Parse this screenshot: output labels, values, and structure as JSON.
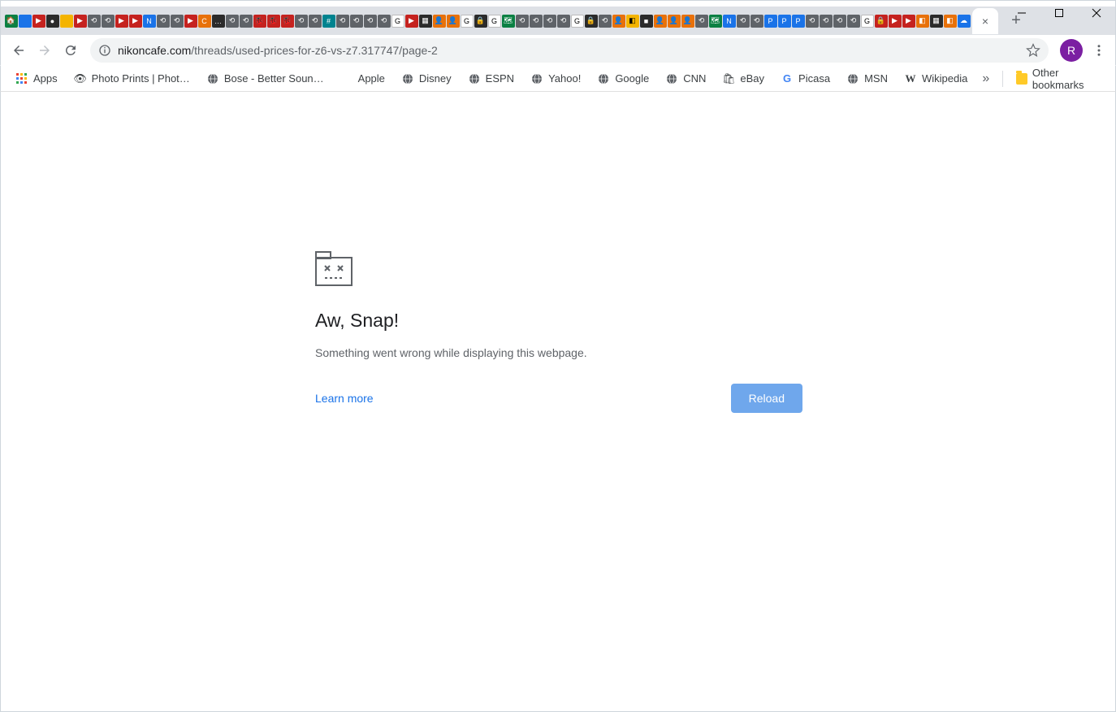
{
  "window": {
    "minimize": "–",
    "maximize": "❐",
    "close": "✕"
  },
  "toolbar": {
    "url_host": "nikoncafe.com",
    "url_path": "/threads/used-prices-for-z6-vs-z7.317747/page-2",
    "profile_initial": "R"
  },
  "bookmarks": {
    "apps": "Apps",
    "items": [
      {
        "label": "Photo Prints | Phot…",
        "icon": "camera"
      },
      {
        "label": "Bose - Better Soun…",
        "icon": "globe"
      },
      {
        "label": "Apple",
        "icon": "apple"
      },
      {
        "label": "Disney",
        "icon": "globe"
      },
      {
        "label": "ESPN",
        "icon": "globe"
      },
      {
        "label": "Yahoo!",
        "icon": "globe"
      },
      {
        "label": "Google",
        "icon": "globe"
      },
      {
        "label": "CNN",
        "icon": "globe"
      },
      {
        "label": "eBay",
        "icon": "bag"
      },
      {
        "label": "Picasa",
        "icon": "google"
      },
      {
        "label": "MSN",
        "icon": "globe"
      },
      {
        "label": "Wikipedia",
        "icon": "wiki"
      }
    ],
    "overflow": "»",
    "other": "Other bookmarks"
  },
  "tabs": {
    "mini_count": 70,
    "new_tab": "+",
    "close": "×"
  },
  "error": {
    "title": "Aw, Snap!",
    "description": "Something went wrong while displaying this webpage.",
    "learn_more": "Learn more",
    "reload": "Reload"
  }
}
